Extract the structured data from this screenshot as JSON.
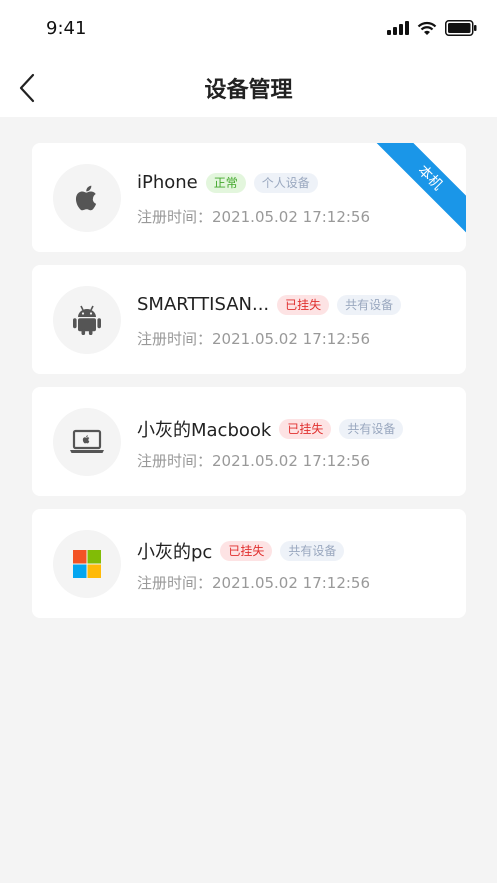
{
  "status_bar": {
    "time": "9:41"
  },
  "nav": {
    "title": "设备管理"
  },
  "devices": [
    {
      "name": "iPhone",
      "status": "正常",
      "status_kind": "ok",
      "type": "个人设备",
      "register_time": "注册时间：2021.05.02 17:12:56",
      "ribbon": "本机",
      "icon": "apple-icon"
    },
    {
      "name": "SMARTTISAN...",
      "status": "已挂失",
      "status_kind": "lost",
      "type": "共有设备",
      "register_time": "注册时间：2021.05.02 17:12:56",
      "icon": "android-icon"
    },
    {
      "name": "小灰的Macbook",
      "status": "已挂失",
      "status_kind": "lost",
      "type": "共有设备",
      "register_time": "注册时间：2021.05.02 17:12:56",
      "icon": "laptop-icon"
    },
    {
      "name": "小灰的pc",
      "status": "已挂失",
      "status_kind": "lost",
      "type": "共有设备",
      "register_time": "注册时间：2021.05.02 17:12:56",
      "icon": "windows-icon"
    }
  ],
  "colors": {
    "ok": "#43a82d",
    "lost": "#e0302f",
    "ribbon": "#1a96e8"
  }
}
